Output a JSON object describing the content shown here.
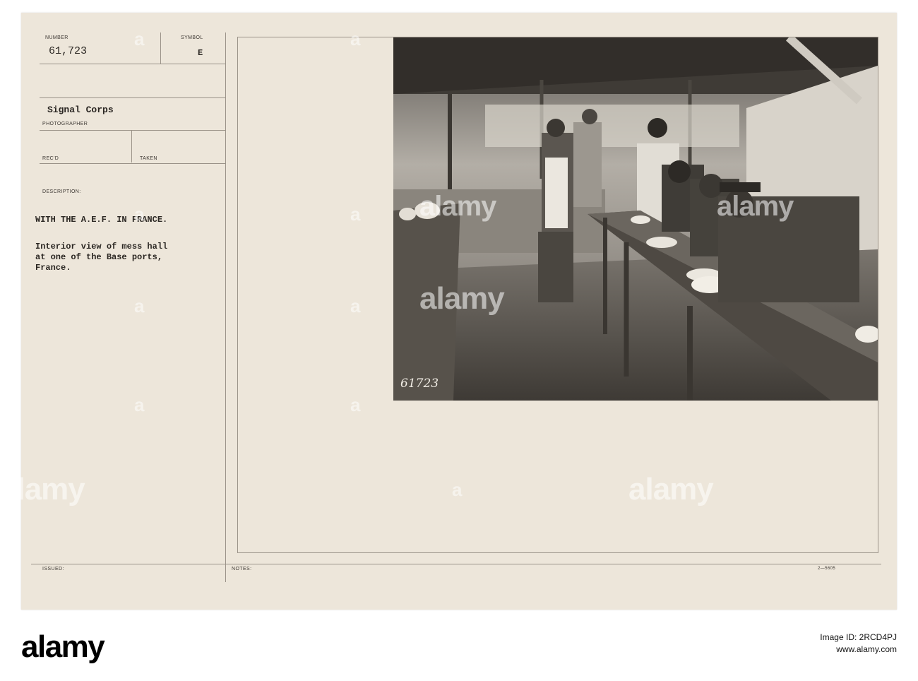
{
  "card": {
    "number_label": "NUMBER",
    "number_value": "61,723",
    "symbol_label": "SYMBOL",
    "symbol_value": "E",
    "photographer_value": "Signal Corps",
    "photographer_label": "PHOTOGRAPHER",
    "recd_label": "REC'D",
    "taken_label": "TAKEN",
    "description_label": "DESCRIPTION:",
    "description_line1": "WITH THE A.E.F. IN FRANCE.",
    "description_line2": "Interior view of mess hall\nat one of the Base ports,\nFrance.",
    "issued_label": "ISSUED:",
    "notes_label": "NOTES:",
    "form_code": "2—5605"
  },
  "photo": {
    "negative_number": "61723"
  },
  "watermark": {
    "text": "alamy",
    "letter": "a"
  },
  "footer": {
    "logo": "alamy",
    "image_id_label": "Image ID: 2RCD4PJ",
    "site": "www.alamy.com"
  },
  "colors": {
    "card": "#ede6da",
    "ink": "#2a2622",
    "photo_tone": "#8e8a84"
  }
}
